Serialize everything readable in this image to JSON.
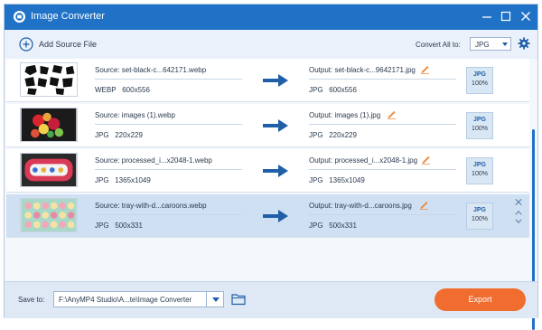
{
  "window": {
    "title": "Image Converter",
    "titlebar_color": "#1f72c6",
    "accent_color": "#f06d2f"
  },
  "toolbar": {
    "add_label": "Add Source File",
    "convert_all_label": "Convert All to:",
    "convert_all_value": "JPG"
  },
  "icons": {
    "app": "app-logo-icon",
    "minimize": "minimize-icon",
    "maximize": "maximize-icon",
    "close": "close-icon",
    "add": "add-circle-icon",
    "settings": "gear-icon",
    "arrow": "arrow-right-icon",
    "edit": "pencil-icon",
    "folder": "folder-icon",
    "remove": "close-icon",
    "move": "chevron-icon"
  },
  "rows": [
    {
      "source": "Source: set-black-c...642171.webp",
      "src_format": "WEBP",
      "src_size": "600x556",
      "output": "Output: set-black-c...9642171.jpg",
      "out_format": "JPG",
      "out_size": "600x556",
      "badge_format": "JPG",
      "badge_quality": "100%"
    },
    {
      "source": "Source: images (1).webp",
      "src_format": "JPG",
      "src_size": "220x229",
      "output": "Output: images (1).jpg",
      "out_format": "JPG",
      "out_size": "220x229",
      "badge_format": "JPG",
      "badge_quality": "100%"
    },
    {
      "source": "Source: processed_i...x2048-1.webp",
      "src_format": "JPG",
      "src_size": "1365x1049",
      "output": "Output: processed_i...x2048-1.jpg",
      "out_format": "JPG",
      "out_size": "1365x1049",
      "badge_format": "JPG",
      "badge_quality": "100%"
    },
    {
      "source": "Source: tray-with-d...caroons.webp",
      "src_format": "JPG",
      "src_size": "500x331",
      "output": "Output: tray-with-d...caroons.jpg",
      "out_format": "JPG",
      "out_size": "500x331",
      "badge_format": "JPG",
      "badge_quality": "100%"
    }
  ],
  "bottom": {
    "save_label": "Save to:",
    "save_path": "F:\\AnyMP4 Studio\\A...te\\Image Converter",
    "export_label": "Export"
  }
}
